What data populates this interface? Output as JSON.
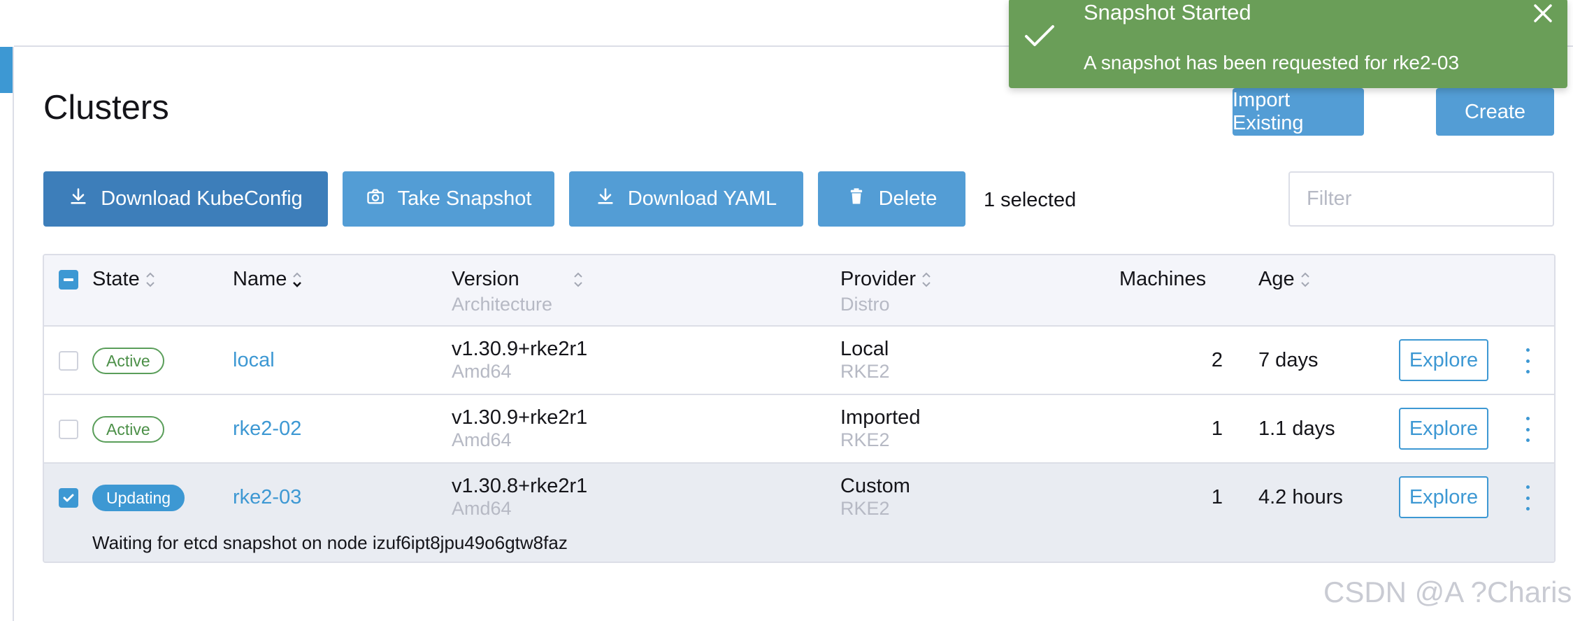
{
  "page": {
    "title": "Clusters"
  },
  "header_actions": {
    "import_label": "Import Existing",
    "create_label": "Create"
  },
  "toolbar": {
    "download_kubeconfig": "Download KubeConfig",
    "take_snapshot": "Take Snapshot",
    "download_yaml": "Download YAML",
    "delete": "Delete",
    "selected_count": "1 selected",
    "filter_placeholder": "Filter",
    "filter_value": ""
  },
  "table": {
    "headers": {
      "state": "State",
      "name": "Name",
      "version": "Version",
      "version_sub": "Architecture",
      "provider": "Provider",
      "provider_sub": "Distro",
      "machines": "Machines",
      "age": "Age"
    },
    "rows": [
      {
        "selected": false,
        "state": "Active",
        "name": "local",
        "version": "v1.30.9+rke2r1",
        "architecture": "Amd64",
        "provider": "Local",
        "distro": "RKE2",
        "machines": "2",
        "age": "7 days",
        "action": "Explore"
      },
      {
        "selected": false,
        "state": "Active",
        "name": "rke2-02",
        "version": "v1.30.9+rke2r1",
        "architecture": "Amd64",
        "provider": "Imported",
        "distro": "RKE2",
        "machines": "1",
        "age": "1.1 days",
        "action": "Explore"
      },
      {
        "selected": true,
        "state": "Updating",
        "name": "rke2-03",
        "version": "v1.30.8+rke2r1",
        "architecture": "Amd64",
        "provider": "Custom",
        "distro": "RKE2",
        "machines": "1",
        "age": "4.2 hours",
        "action": "Explore",
        "status_message": "Waiting for etcd snapshot on node izuf6ipt8jpu49o6gtw8faz"
      }
    ]
  },
  "toast": {
    "title": "Snapshot Started",
    "message": "A snapshot has been requested for rke2-03",
    "color": "#6a9e58",
    "icon": "check-icon"
  },
  "watermark": "CSDN @A ?Charis",
  "colors": {
    "primary": "#539dd5",
    "primary_dark": "#3d7eba",
    "link": "#3d98d3",
    "active_badge": "#5a9e5a"
  }
}
